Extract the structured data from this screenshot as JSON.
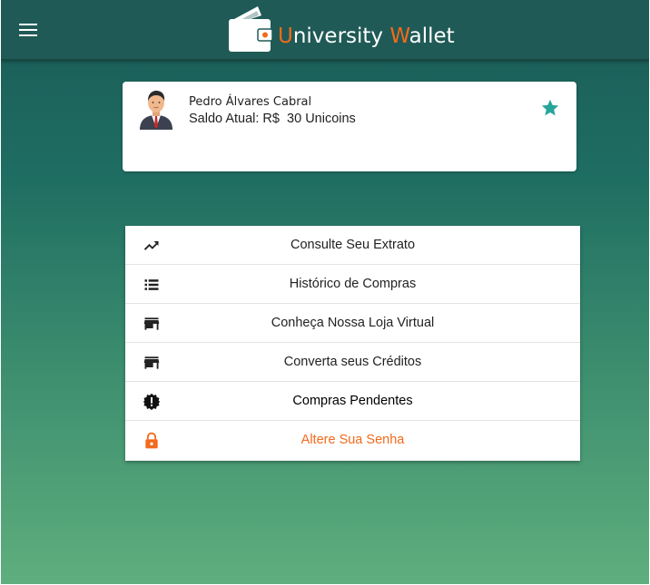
{
  "header": {
    "menu_icon": "hamburger-menu-icon",
    "logo_icon": "wallet-icon",
    "brand_first_initial": "U",
    "brand_first_rest": "niversity",
    "brand_second_initial": "W",
    "brand_second_rest": "allet"
  },
  "profile": {
    "avatar_icon": "businessman-avatar",
    "name": "Pedro Álvares Cabral",
    "balance_label": "Saldo Atual: R$",
    "balance_value": "30 Unicoins",
    "favorite_icon": "star-icon"
  },
  "menu": {
    "items": [
      {
        "icon": "trending-up-icon",
        "label": "Consulte Seu Extrato"
      },
      {
        "icon": "list-icon",
        "label": "Histórico de Compras"
      },
      {
        "icon": "store-icon",
        "label": "Conheça Nossa Loja Virtual"
      },
      {
        "icon": "store-icon",
        "label": "Converta seus Créditos"
      },
      {
        "icon": "alert-badge-icon",
        "label": "Compras Pendentes"
      },
      {
        "icon": "lock-icon",
        "label": "Altere Sua Senha"
      }
    ]
  },
  "colors": {
    "header_bg": "#1f5a56",
    "accent_orange": "#f26a1b",
    "star_teal": "#26a69a",
    "gradient_top": "#1b5b57",
    "gradient_bottom": "#5fae7e"
  }
}
